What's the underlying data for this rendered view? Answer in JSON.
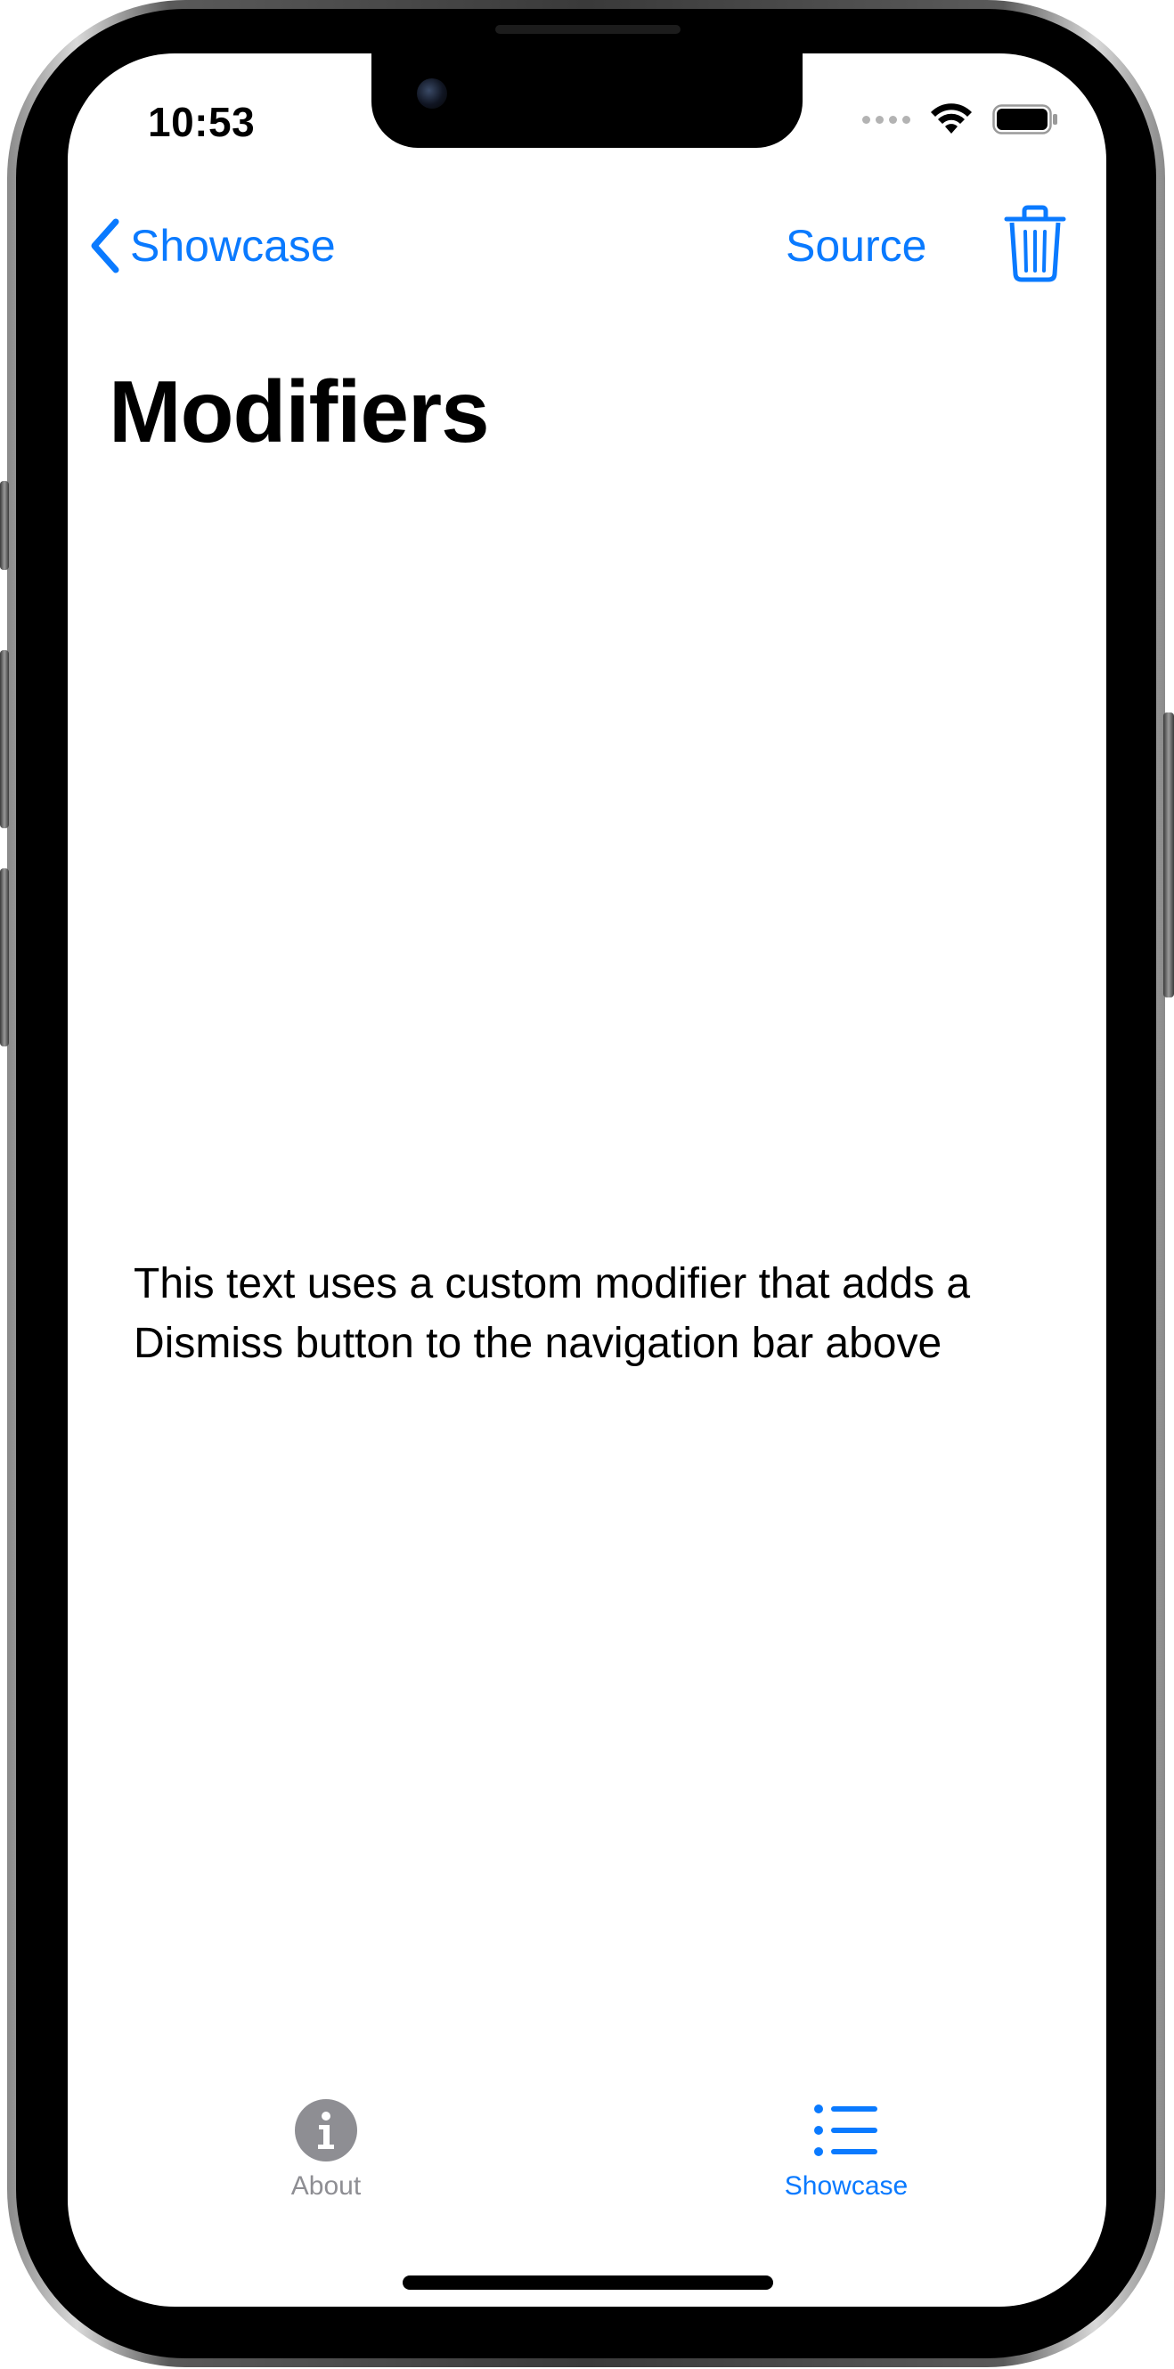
{
  "status_bar": {
    "time": "10:53"
  },
  "nav": {
    "back_label": "Showcase",
    "source_label": "Source"
  },
  "page": {
    "title": "Modifiers",
    "body": "This text uses a custom modifier that adds a Dismiss button to the navigation bar above"
  },
  "tab_bar": {
    "tabs": [
      {
        "label": "About",
        "icon": "info-circle-icon",
        "selected": false
      },
      {
        "label": "Showcase",
        "icon": "list-bullet-icon",
        "selected": true
      }
    ]
  },
  "colors": {
    "accent": "#0A7AFF",
    "inactive_tab": "#8E8E93",
    "text": "#000000",
    "background": "#FFFFFF"
  }
}
